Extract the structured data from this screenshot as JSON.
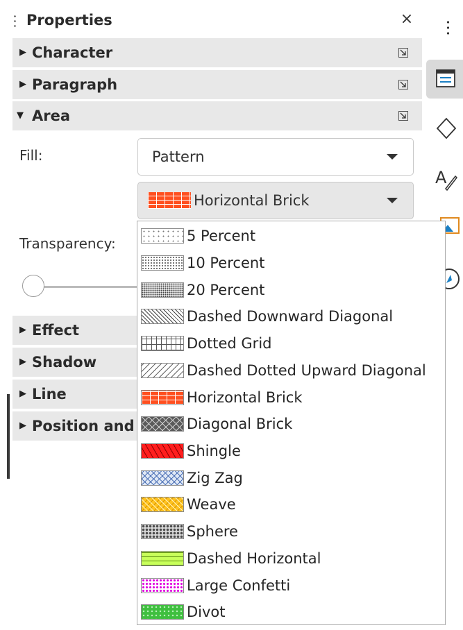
{
  "panel": {
    "title": "Properties",
    "close_label": "×",
    "sections": {
      "character": "Character",
      "paragraph": "Paragraph",
      "area": "Area",
      "effect": "Effect",
      "shadow": "Shadow",
      "line": "Line",
      "position": "Position and"
    },
    "area": {
      "fill_label": "Fill:",
      "fill_value": "Pattern",
      "pattern_value": "Horizontal Brick",
      "transparency_label": "Transparency:"
    }
  },
  "pattern_list": [
    {
      "label": "5 Percent",
      "icon": "pattern-5-percent"
    },
    {
      "label": "10 Percent",
      "icon": "pattern-10-percent"
    },
    {
      "label": "20 Percent",
      "icon": "pattern-20-percent"
    },
    {
      "label": "Dashed Downward Diagonal",
      "icon": "pattern-dashed-downward-diagonal"
    },
    {
      "label": "Dotted Grid",
      "icon": "pattern-dotted-grid"
    },
    {
      "label": "Dashed Dotted Upward Diagonal",
      "icon": "pattern-dashed-dotted-upward-diagonal"
    },
    {
      "label": "Horizontal Brick",
      "icon": "pattern-horizontal-brick"
    },
    {
      "label": "Diagonal Brick",
      "icon": "pattern-diagonal-brick"
    },
    {
      "label": "Shingle",
      "icon": "pattern-shingle"
    },
    {
      "label": "Zig Zag",
      "icon": "pattern-zig-zag"
    },
    {
      "label": "Weave",
      "icon": "pattern-weave"
    },
    {
      "label": "Sphere",
      "icon": "pattern-sphere"
    },
    {
      "label": "Dashed Horizontal",
      "icon": "pattern-dashed-horizontal"
    },
    {
      "label": "Large Confetti",
      "icon": "pattern-large-confetti"
    },
    {
      "label": "Divot",
      "icon": "pattern-divot"
    }
  ],
  "colors": {
    "section_bg": "#e8e8e8",
    "horizontal_brick": "#ff4f1f",
    "sidebar_active_tab": "#d9d9d9",
    "accent_blue": "#1a7fc4"
  }
}
